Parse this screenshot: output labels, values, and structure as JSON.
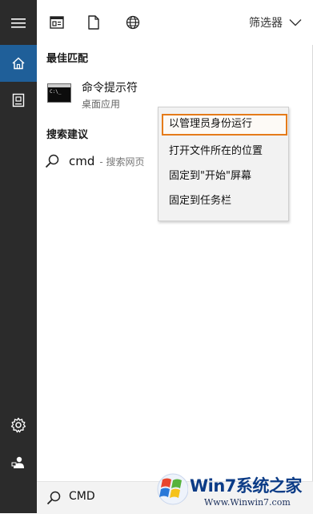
{
  "toolbar": {
    "filter_label": "筛选器",
    "icons": [
      "apps-grid-icon",
      "document-icon",
      "globe-icon",
      "chevron-down-icon"
    ]
  },
  "rail": {
    "icons": [
      "hamburger-menu-icon",
      "home-icon",
      "tablet-icon",
      "settings-gear-icon",
      "user-feedback-icon"
    ]
  },
  "best_match": {
    "heading": "最佳匹配",
    "app_name": "命令提示符",
    "app_type": "桌面应用",
    "icon_text": "C:\\_"
  },
  "suggestions": {
    "heading": "搜索建议",
    "items": [
      {
        "query": "cmd",
        "detail": "- 搜索网页"
      }
    ]
  },
  "context_menu": {
    "items": [
      {
        "label": "以管理员身份运行",
        "highlighted": true
      },
      {
        "label": "打开文件所在的位置",
        "highlighted": false
      },
      {
        "label": "固定到\"开始\"屏幕",
        "highlighted": false
      },
      {
        "label": "固定到任务栏",
        "highlighted": false
      }
    ]
  },
  "search": {
    "value": "CMD"
  },
  "watermark": {
    "brand": "Win7系统之家",
    "url": "Www.Winwin7.com"
  },
  "colors": {
    "rail_bg": "#2b2b2b",
    "rail_active": "#1f5f99",
    "highlight_border": "#e57b1a",
    "menu_bg": "#f2f2f2"
  }
}
